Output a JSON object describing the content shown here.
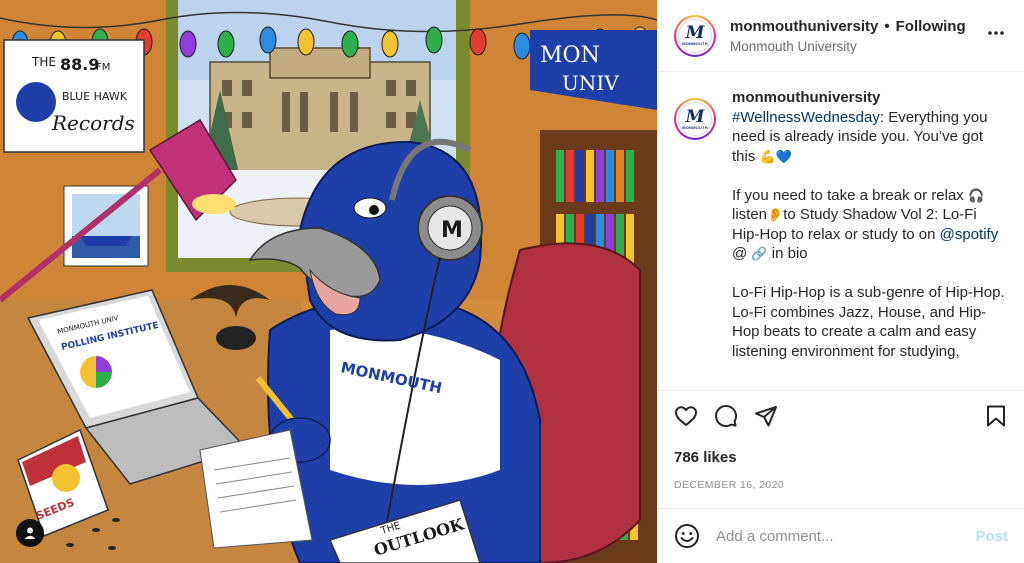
{
  "header": {
    "username": "monmouthuniversity",
    "separator": "•",
    "follow_status": "Following",
    "display_name": "Monmouth University",
    "more_icon": "more-horizontal-icon"
  },
  "avatar": {
    "letter": "M",
    "wordmark": "MONMOUTH"
  },
  "caption": {
    "username": "monmouthuniversity",
    "hashtag": "#WellnessWednesday",
    "line1_rest": ": Everything you need is already inside you. You’ve got this ",
    "line1_emoji": "💪💙",
    "p2_part1": "If you need to take a break or relax ",
    "p2_emoji1": "🎧",
    "p2_part2": " listen",
    "p2_emoji2": "👂",
    "p2_part3": "to Study Shadow Vol 2: Lo-Fi Hip-Hop to relax or study to on ",
    "p2_mention": "@spotify",
    "p2_part4": " @ ",
    "p2_emoji3": "🔗",
    "p2_part5": " in bio",
    "p3": "Lo-Fi Hip-Hop is a sub-genre of Hip-Hop. Lo-Fi combines Jazz, House, and Hip-Hop beats to create a calm and easy listening environment for studying,"
  },
  "actions": {
    "like_icon": "heart-icon",
    "comment_icon": "comment-icon",
    "share_icon": "paper-plane-icon",
    "save_icon": "bookmark-icon"
  },
  "likes": "786 likes",
  "date": "DECEMBER 16, 2020",
  "comment": {
    "placeholder": "Add a comment...",
    "post_label": "Post",
    "emoji_icon": "smiley-icon"
  },
  "illustration": {
    "radio_sign_line1": "THE",
    "radio_sign_freq": "88.9",
    "radio_sign_fm": "FM",
    "radio_sign_line2": "BLUE HAWK",
    "radio_sign_line3": "Records",
    "pennant_text": "MONMOUTH UNIVERSITY",
    "pennant_visible": "MON UNIV",
    "laptop_line1": "MONMOUTH UNIV",
    "laptop_line2": "POLLING INSTITUTE",
    "seeds_label": "SEEDS",
    "newspaper_line1": "THE",
    "newspaper_line2": "OUTLOOK",
    "mascot_shirt": "MONMOUTH",
    "headphone_letter": "M",
    "colors": {
      "hawk_blue": "#1f3fa8",
      "wall_orange": "#d48a3a",
      "chair_red": "#b0303f"
    }
  }
}
